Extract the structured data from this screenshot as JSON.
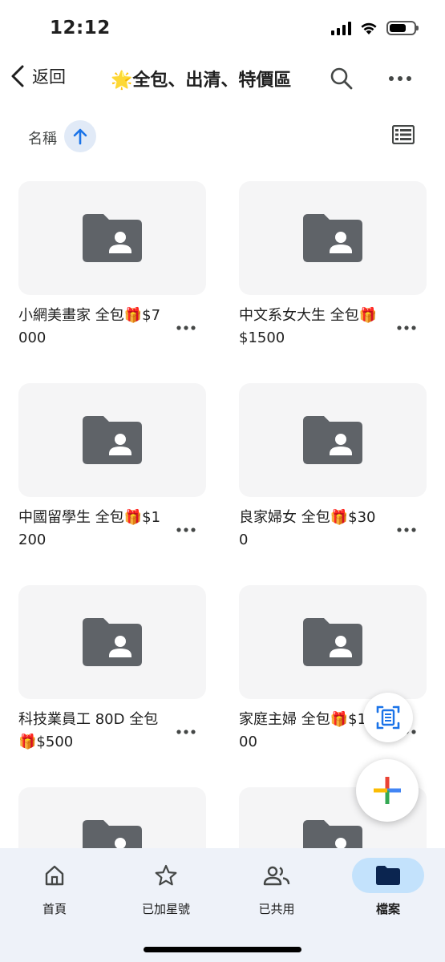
{
  "status_bar": {
    "time": "12:12",
    "battery_level": 0.7
  },
  "header": {
    "back_label": "返回",
    "title": "🌟全包、出清、特價區"
  },
  "sort": {
    "label": "名稱",
    "direction": "ascending"
  },
  "folders": [
    {
      "name": "小網美畫家 全包🎁$7000"
    },
    {
      "name": "中文系女大生 全包🎁$1500"
    },
    {
      "name": "中國留學生 全包🎁$1200"
    },
    {
      "name": "良家婦女 全包🎁$300"
    },
    {
      "name": "科技業員工 80D 全包🎁$500"
    },
    {
      "name": "家庭主婦 全包🎁$1800"
    },
    {
      "name": ""
    },
    {
      "name": ""
    }
  ],
  "bottom_nav": [
    {
      "label": "首頁",
      "icon": "home-icon",
      "active": false
    },
    {
      "label": "已加星號",
      "icon": "star-icon",
      "active": false
    },
    {
      "label": "已共用",
      "icon": "shared-people-icon",
      "active": false
    },
    {
      "label": "檔案",
      "icon": "folder-icon",
      "active": true
    }
  ],
  "colors": {
    "accent": "#1a73e8",
    "folder_icon": "#5f6368",
    "nav_active_pill": "#c3e2fc",
    "nav_background": "#eef2f9",
    "thumb_background": "#f5f5f6"
  }
}
